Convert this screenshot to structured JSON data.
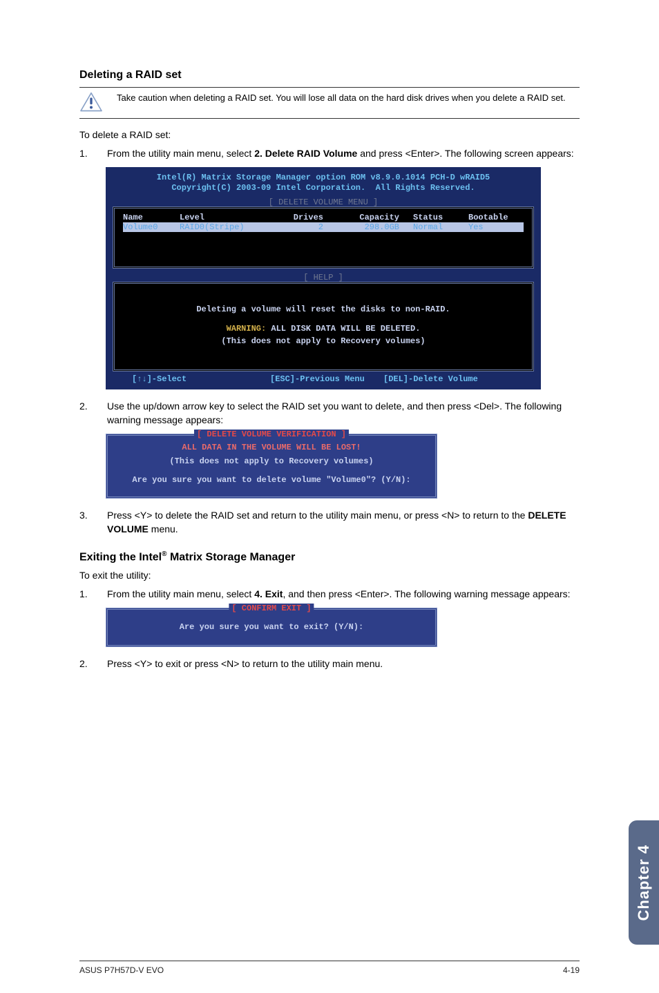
{
  "section1": {
    "heading": "Deleting a RAID set",
    "caution": "Take caution when deleting a RAID set. You will lose all data on the hard disk drives when you delete a RAID set.",
    "intro": "To delete a RAID set:",
    "step1_a": "From the utility main menu, select ",
    "step1_b": "2. Delete RAID Volume",
    "step1_c": " and press <Enter>. The following screen appears:",
    "step2": "Use the up/down arrow key to select the RAID set you want to delete, and then press <Del>. The following warning message appears:",
    "step3_a": "Press <Y> to delete the RAID set and return to the utility main menu, or press <N> to return to the ",
    "step3_b": "DELETE VOLUME",
    "step3_c": " menu."
  },
  "bios": {
    "t1": "Intel(R) Matrix Storage Manager option ROM v8.9.0.1014 PCH-D wRAID5",
    "t2": "Copyright(C) 2003-09 Intel Corporation.  All Rights Reserved.",
    "frame_delete": "[ DELETE VOLUME MENU ]",
    "frame_help": "[ HELP ]",
    "hdr": {
      "c1": "Name",
      "c2": "Level",
      "c3": "Drives",
      "c4": "Capacity",
      "c5": "Status",
      "c6": "Bootable"
    },
    "row": {
      "c1": "Volume0",
      "c2": "RAID0(Stripe)",
      "c3": "2",
      "c4": "298.0GB",
      "c5": "Normal",
      "c6": "Yes"
    },
    "help1": "Deleting a volume will reset the disks to non-RAID.",
    "help_warn_a": "WARNING:",
    "help_warn_b": " ALL DISK DATA WILL BE DELETED.",
    "help3": "(This does not apply to Recovery volumes)",
    "keybar": {
      "k1": "[↑↓]-Select",
      "k2": "[ESC]-Previous Menu",
      "k3": "[DEL]-Delete Volume"
    }
  },
  "dlg1": {
    "title": "[ DELETE VOLUME VERIFICATION ]",
    "l1": "ALL DATA IN THE VOLUME WILL BE LOST!",
    "l2": "(This does not apply to Recovery volumes)",
    "l3": "Are you sure you want to delete volume \"Volume0\"? (Y/N):"
  },
  "section2": {
    "heading_a": "Exiting the Intel",
    "heading_reg": "®",
    "heading_b": " Matrix Storage Manager",
    "intro": "To exit the utility:",
    "step1_a": "From the utility main menu, select ",
    "step1_b": "4. Exit",
    "step1_c": ", and then press <Enter>. The following warning message appears:",
    "step2": "Press <Y> to exit or press <N> to return to the utility main menu."
  },
  "dlg2": {
    "title": "[ CONFIRM EXIT ]",
    "l1": "Are you sure you want to exit? (Y/N):"
  },
  "tab": "Chapter 4",
  "footer": {
    "left": "ASUS P7H57D-V EVO",
    "right": "4-19"
  }
}
